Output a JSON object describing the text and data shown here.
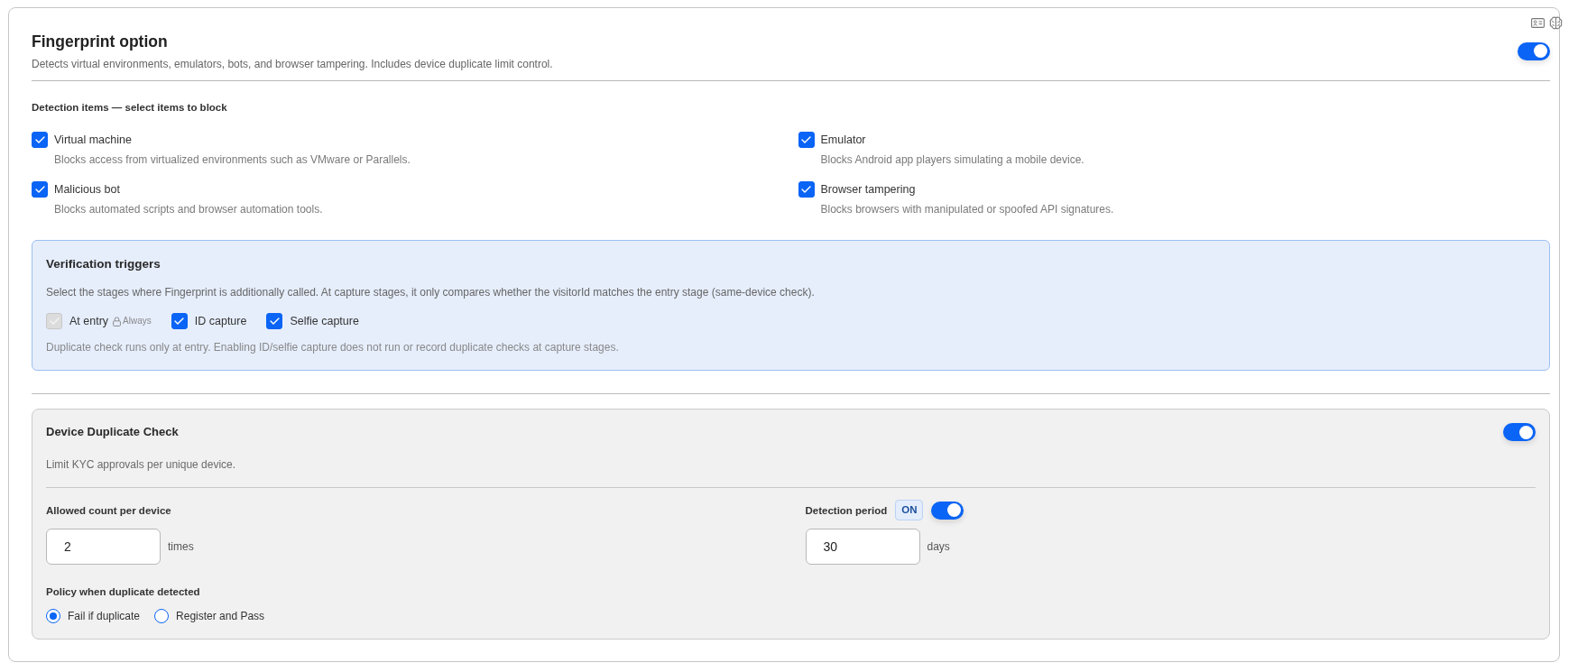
{
  "header": {
    "title": "Fingerprint option",
    "description": "Detects virtual environments, emulators, bots, and browser tampering. Includes device duplicate limit control.",
    "enabled": true
  },
  "detection": {
    "heading": "Detection items — select items to block",
    "items": [
      {
        "label": "Virtual machine",
        "description": "Blocks access from virtualized environments such as VMware or Parallels.",
        "checked": true
      },
      {
        "label": "Emulator",
        "description": "Blocks Android app players simulating a mobile device.",
        "checked": true
      },
      {
        "label": "Malicious bot",
        "description": "Blocks automated scripts and browser automation tools.",
        "checked": true
      },
      {
        "label": "Browser tampering",
        "description": "Blocks browsers with manipulated or spoofed API signatures.",
        "checked": true
      }
    ]
  },
  "triggers": {
    "title": "Verification triggers",
    "description": "Select the stages where Fingerprint is additionally called. At capture stages, it only compares whether the visitorId matches the entry stage (same-device check).",
    "stages": [
      {
        "label": "At entry",
        "checked": true,
        "disabled": true,
        "badge": "Always"
      },
      {
        "label": "ID capture",
        "checked": true,
        "disabled": false
      },
      {
        "label": "Selfie capture",
        "checked": true,
        "disabled": false
      }
    ],
    "note": "Duplicate check runs only at entry. Enabling ID/selfie capture does not run or record duplicate checks at capture stages."
  },
  "duplicate_check": {
    "title": "Device Duplicate Check",
    "enabled": true,
    "description": "Limit KYC approvals per unique device.",
    "allowed_count": {
      "label": "Allowed count per device",
      "value": "2",
      "unit": "times"
    },
    "detection_period": {
      "label": "Detection period",
      "badge": "ON",
      "enabled": true,
      "value": "30",
      "unit": "days"
    },
    "policy": {
      "label": "Policy when duplicate detected",
      "options": [
        {
          "label": "Fail if duplicate",
          "selected": true
        },
        {
          "label": "Register and Pass",
          "selected": false
        }
      ]
    }
  }
}
